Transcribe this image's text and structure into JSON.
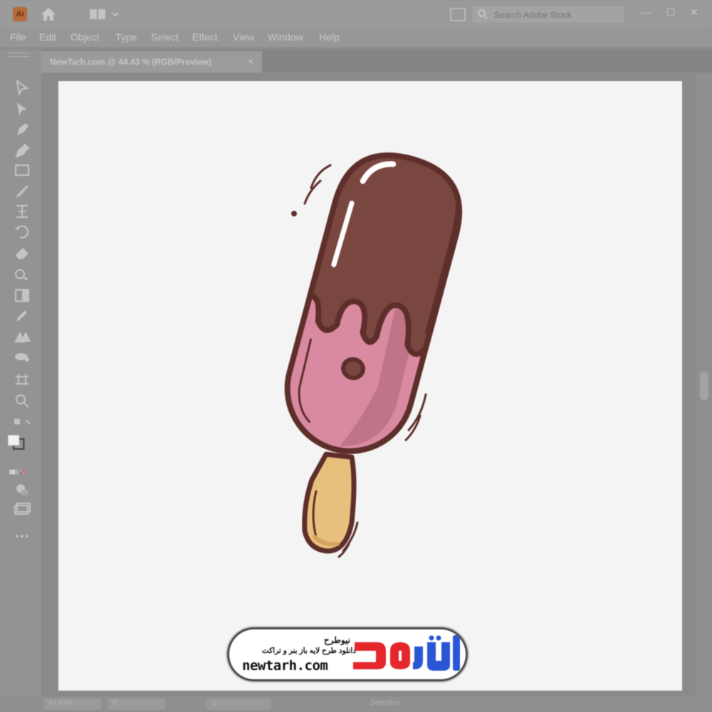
{
  "app": {
    "logo_text": "Ai"
  },
  "search": {
    "placeholder": "Search Adobe Stock"
  },
  "window_controls": {
    "minimize": "—",
    "maximize": "☐",
    "close": "✕"
  },
  "menu": {
    "items": [
      "File",
      "Edit",
      "Object",
      "Type",
      "Select",
      "Effect",
      "View",
      "Window",
      "Help"
    ]
  },
  "document_tab": {
    "label": "NewTarh.com @ 44.43 % (RGB/Preview)",
    "close": "×"
  },
  "tools": [
    "direct-selection-tool-icon",
    "selection-tool-icon",
    "pen-tool-icon",
    "curvature-tool-icon",
    "rectangle-tool-icon",
    "paintbrush-tool-icon",
    "width-tool-icon",
    "rotate-tool-icon",
    "eraser-tool-icon",
    "shape-builder-tool-icon",
    "gradient-tool-icon",
    "eyedropper-tool-icon",
    "blend-tool-icon",
    "symbol-sprayer-tool-icon",
    "artboard-tool-icon",
    "zoom-tool-icon"
  ],
  "status": {
    "zoom": "44.43%",
    "rotation": "0°",
    "artboard_number": "1",
    "mode": "Selection"
  },
  "watermark": {
    "title": "نیوطرح",
    "subtitle": "دانلود طرح لایه باز بنر و تراکت",
    "url": "newtarh.com",
    "logo_text": "نیوطرح"
  },
  "colors": {
    "chocolate": "#7a4640",
    "chocolate_outline": "#5e2e2b",
    "ice_cream_pink": "#d98aa0",
    "ice_cream_shadow": "#c07488",
    "stick": "#e8c07d",
    "stick_shadow": "#d4a45e",
    "logo_blue": "#2a56d6",
    "logo_red": "#e5262b",
    "artboard": "#f4f4f4"
  }
}
